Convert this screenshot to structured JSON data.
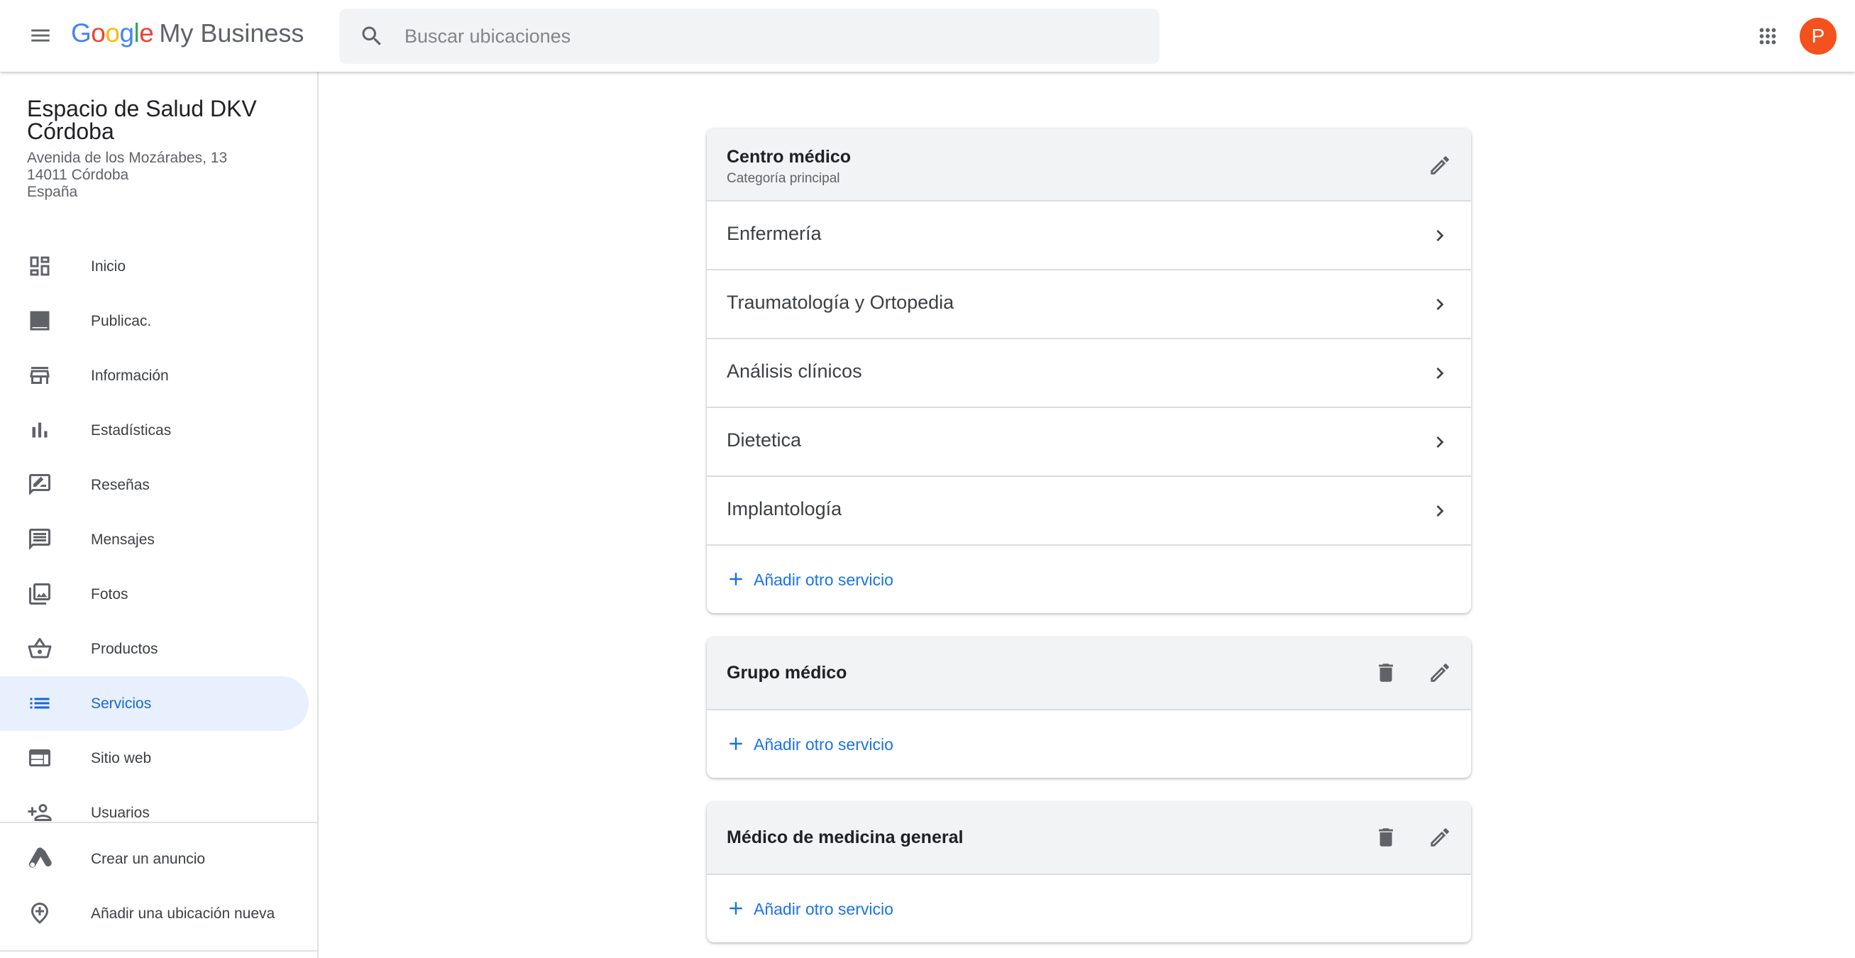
{
  "header": {
    "logo_google": [
      "G",
      "o",
      "o",
      "g",
      "l",
      "e"
    ],
    "logo_product": "My Business",
    "search_placeholder": "Buscar ubicaciones",
    "avatar_letter": "P"
  },
  "business": {
    "name": "Espacio de Salud DKV Córdoba",
    "address_line1": "Avenida de los Mozárabes, 13",
    "address_line2": "14011 Córdoba",
    "address_line3": "España"
  },
  "nav": {
    "items": [
      {
        "label": "Inicio",
        "icon": "dashboard-icon"
      },
      {
        "label": "Publicac.",
        "icon": "posts-icon"
      },
      {
        "label": "Información",
        "icon": "storefront-icon"
      },
      {
        "label": "Estadísticas",
        "icon": "bar-chart-icon"
      },
      {
        "label": "Reseñas",
        "icon": "rate-review-icon"
      },
      {
        "label": "Mensajes",
        "icon": "message-icon"
      },
      {
        "label": "Fotos",
        "icon": "photo-library-icon"
      },
      {
        "label": "Productos",
        "icon": "basket-icon"
      },
      {
        "label": "Servicios",
        "icon": "list-icon",
        "active": true
      },
      {
        "label": "Sitio web",
        "icon": "web-icon"
      },
      {
        "label": "Usuarios",
        "icon": "add-person-icon"
      }
    ],
    "secondary": [
      {
        "label": "Crear un anuncio",
        "icon": "google-ads-icon"
      },
      {
        "label": "Añadir una ubicación nueva",
        "icon": "add-location-icon"
      }
    ]
  },
  "colors": {
    "accent": "#1a73e8",
    "active_bg": "#e8f0fe",
    "avatar": "#f4511e"
  },
  "categories": [
    {
      "title": "Centro médico",
      "subtitle": "Categoría principal",
      "services": [
        "Enfermería",
        "Traumatología y Ortopedia",
        "Análisis clínicos",
        "Dietetica",
        "Implantología"
      ],
      "add_label": "Añadir otro servicio"
    },
    {
      "title": "Grupo médico",
      "services": [],
      "add_label": "Añadir otro servicio"
    },
    {
      "title": "Médico de medicina general",
      "services": [],
      "add_label": "Añadir otro servicio"
    }
  ]
}
